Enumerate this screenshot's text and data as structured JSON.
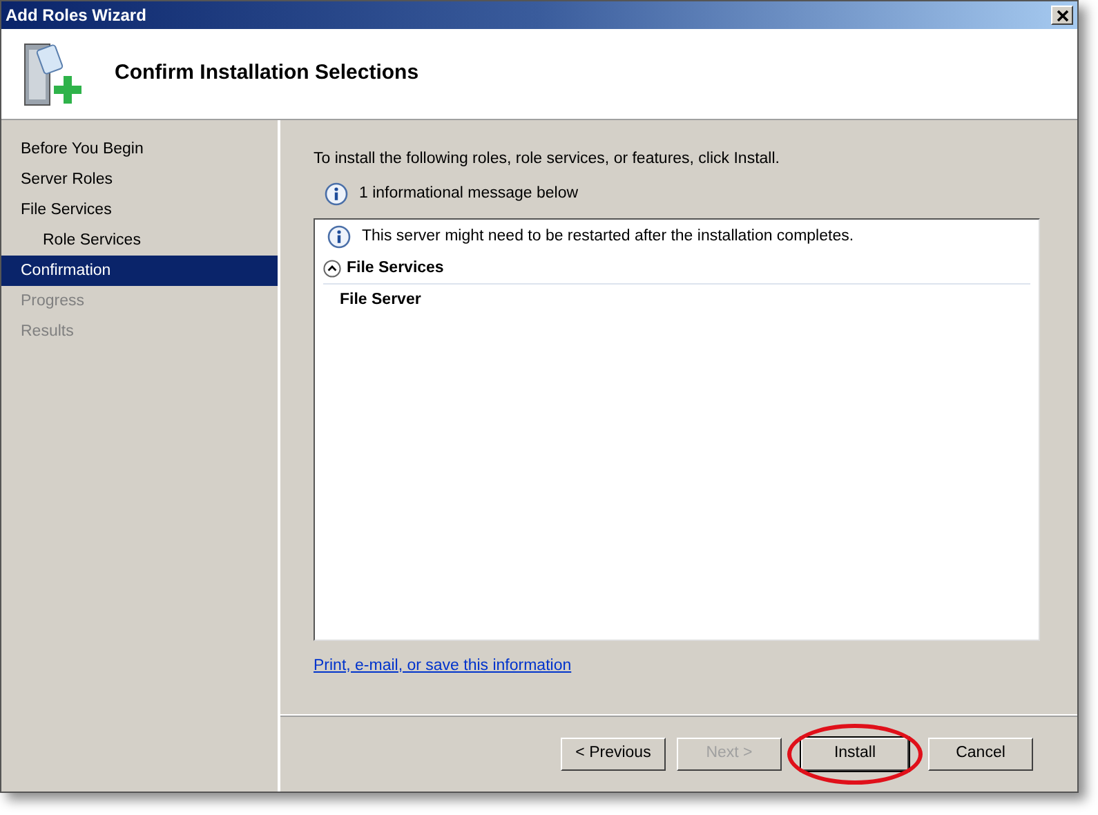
{
  "window": {
    "title": "Add Roles Wizard"
  },
  "header": {
    "title": "Confirm Installation Selections"
  },
  "sidebar": {
    "items": [
      {
        "label": "Before You Begin",
        "selected": false,
        "disabled": false
      },
      {
        "label": "Server Roles",
        "selected": false,
        "disabled": false
      },
      {
        "label": "File Services",
        "selected": false,
        "disabled": false,
        "children": [
          {
            "label": "Role Services",
            "selected": false,
            "disabled": false
          }
        ]
      },
      {
        "label": "Confirmation",
        "selected": true,
        "disabled": false
      },
      {
        "label": "Progress",
        "selected": false,
        "disabled": true
      },
      {
        "label": "Results",
        "selected": false,
        "disabled": true
      }
    ]
  },
  "content": {
    "intro": "To install the following roles, role services, or features, click Install.",
    "info_count": "1 informational message below",
    "messages": [
      {
        "text": "This server might need to be restarted after the installation completes."
      }
    ],
    "sections": [
      {
        "title": "File Services",
        "expanded": true,
        "items": [
          "File Server"
        ]
      }
    ],
    "link": "Print, e-mail, or save this information"
  },
  "buttons": [
    {
      "label": "< Previous",
      "disabled": false,
      "default": false,
      "highlighted": false
    },
    {
      "label": "Next >",
      "disabled": true,
      "default": false,
      "highlighted": false
    },
    {
      "label": "Install",
      "disabled": false,
      "default": true,
      "highlighted": true
    },
    {
      "label": "Cancel",
      "disabled": false,
      "default": false,
      "highlighted": false
    }
  ]
}
